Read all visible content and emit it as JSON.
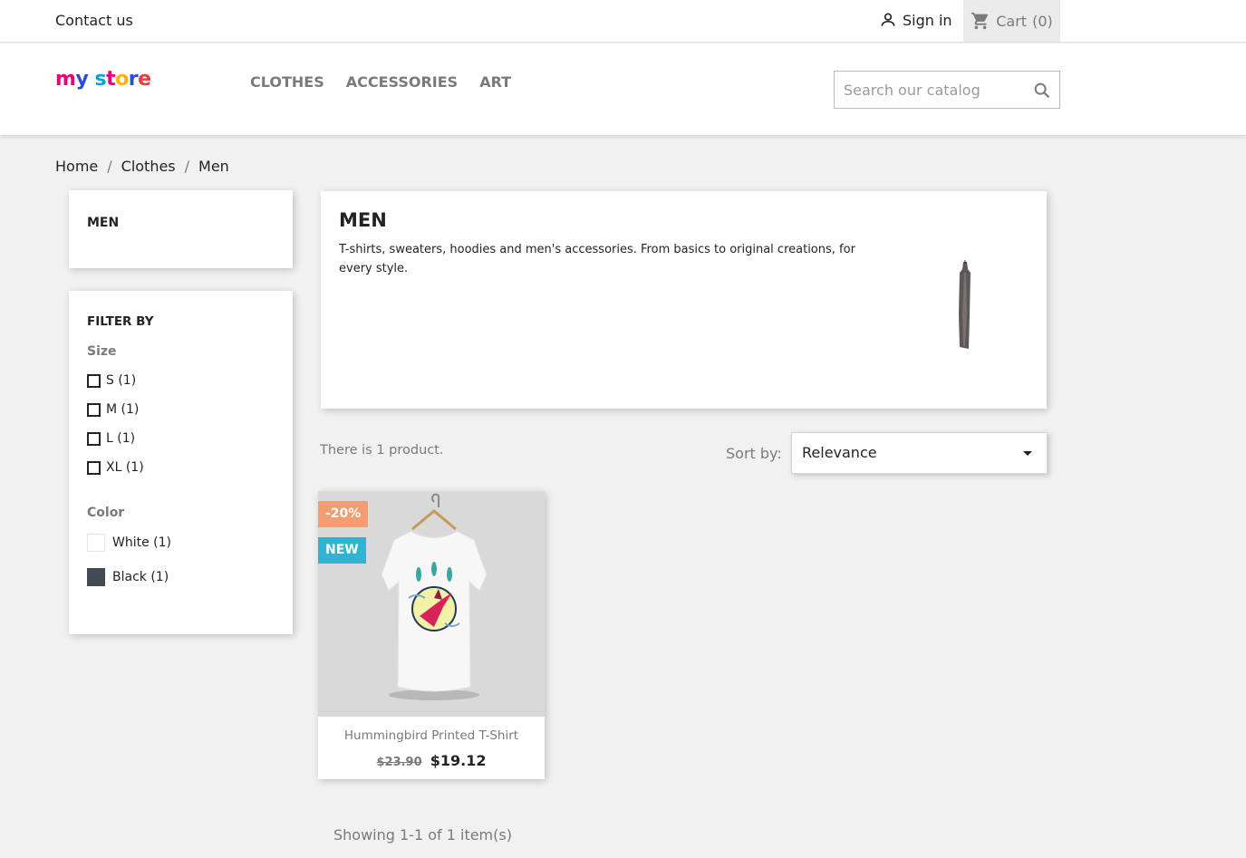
{
  "top_nav": {
    "contact": "Contact us",
    "signin": "Sign in",
    "cart": "Cart",
    "cart_count": "(0)"
  },
  "header": {
    "logo_text": "my store",
    "menu": [
      "CLOTHES",
      "ACCESSORIES",
      "ART"
    ],
    "search_placeholder": "Search our catalog"
  },
  "breadcrumb": [
    "Home",
    "Clothes",
    "Men"
  ],
  "sidebar": {
    "category_title": "MEN",
    "filter_title": "FILTER BY",
    "facets": {
      "size_label": "Size",
      "sizes": [
        "S (1)",
        "M (1)",
        "L (1)",
        "XL (1)"
      ],
      "color_label": "Color",
      "colors": [
        {
          "label": "White (1)",
          "hex": "#ffffff"
        },
        {
          "label": "Black (1)",
          "hex": "#434a54"
        }
      ]
    }
  },
  "category": {
    "title": "MEN",
    "description": "T-shirts, sweaters, hoodies and men's accessories. From basics to original creations, for every style."
  },
  "listing": {
    "count_text": "There is 1 product.",
    "sort_label": "Sort by:",
    "sort_value": "Relevance",
    "pagination_summary": "Showing 1-1 of 1 item(s)"
  },
  "products": [
    {
      "name": "Hummingbird Printed T-Shirt",
      "regular_price": "$23.90",
      "price": "$19.12",
      "flag_discount": "-20%",
      "flag_new": "NEW"
    }
  ],
  "colors": {
    "accent": "#2fb5d2",
    "discount_flag": "#f39d72",
    "page_bg": "#f1f1f1"
  }
}
